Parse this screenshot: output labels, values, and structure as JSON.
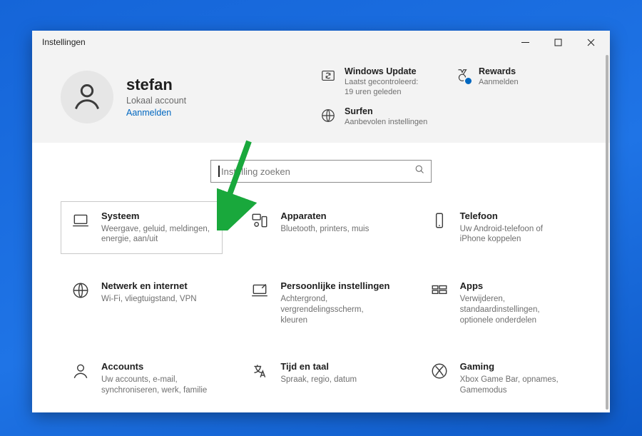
{
  "window": {
    "title": "Instellingen"
  },
  "user": {
    "name": "stefan",
    "account_type": "Lokaal account",
    "signin_label": "Aanmelden"
  },
  "quick": {
    "update": {
      "title": "Windows Update",
      "desc": "Laatst gecontroleerd:\n19 uren geleden"
    },
    "rewards": {
      "title": "Rewards",
      "desc": "Aanmelden"
    },
    "surf": {
      "title": "Surfen",
      "desc": "Aanbevolen instellingen"
    }
  },
  "search": {
    "placeholder": "Instelling zoeken"
  },
  "categories": [
    {
      "key": "system",
      "title": "Systeem",
      "desc": "Weergave, geluid, meldingen, energie, aan/uit"
    },
    {
      "key": "devices",
      "title": "Apparaten",
      "desc": "Bluetooth, printers, muis"
    },
    {
      "key": "phone",
      "title": "Telefoon",
      "desc": "Uw Android-telefoon of iPhone koppelen"
    },
    {
      "key": "network",
      "title": "Netwerk en internet",
      "desc": "Wi-Fi, vliegtuigstand, VPN"
    },
    {
      "key": "personal",
      "title": "Persoonlijke instellingen",
      "desc": "Achtergrond, vergrendelingsscherm, kleuren"
    },
    {
      "key": "apps",
      "title": "Apps",
      "desc": "Verwijderen, standaardinstellingen, optionele onderdelen"
    },
    {
      "key": "accounts",
      "title": "Accounts",
      "desc": "Uw accounts, e-mail, synchroniseren, werk, familie"
    },
    {
      "key": "time",
      "title": "Tijd en taal",
      "desc": "Spraak, regio, datum"
    },
    {
      "key": "gaming",
      "title": "Gaming",
      "desc": "Xbox Game Bar, opnames, Gamemodus"
    }
  ]
}
